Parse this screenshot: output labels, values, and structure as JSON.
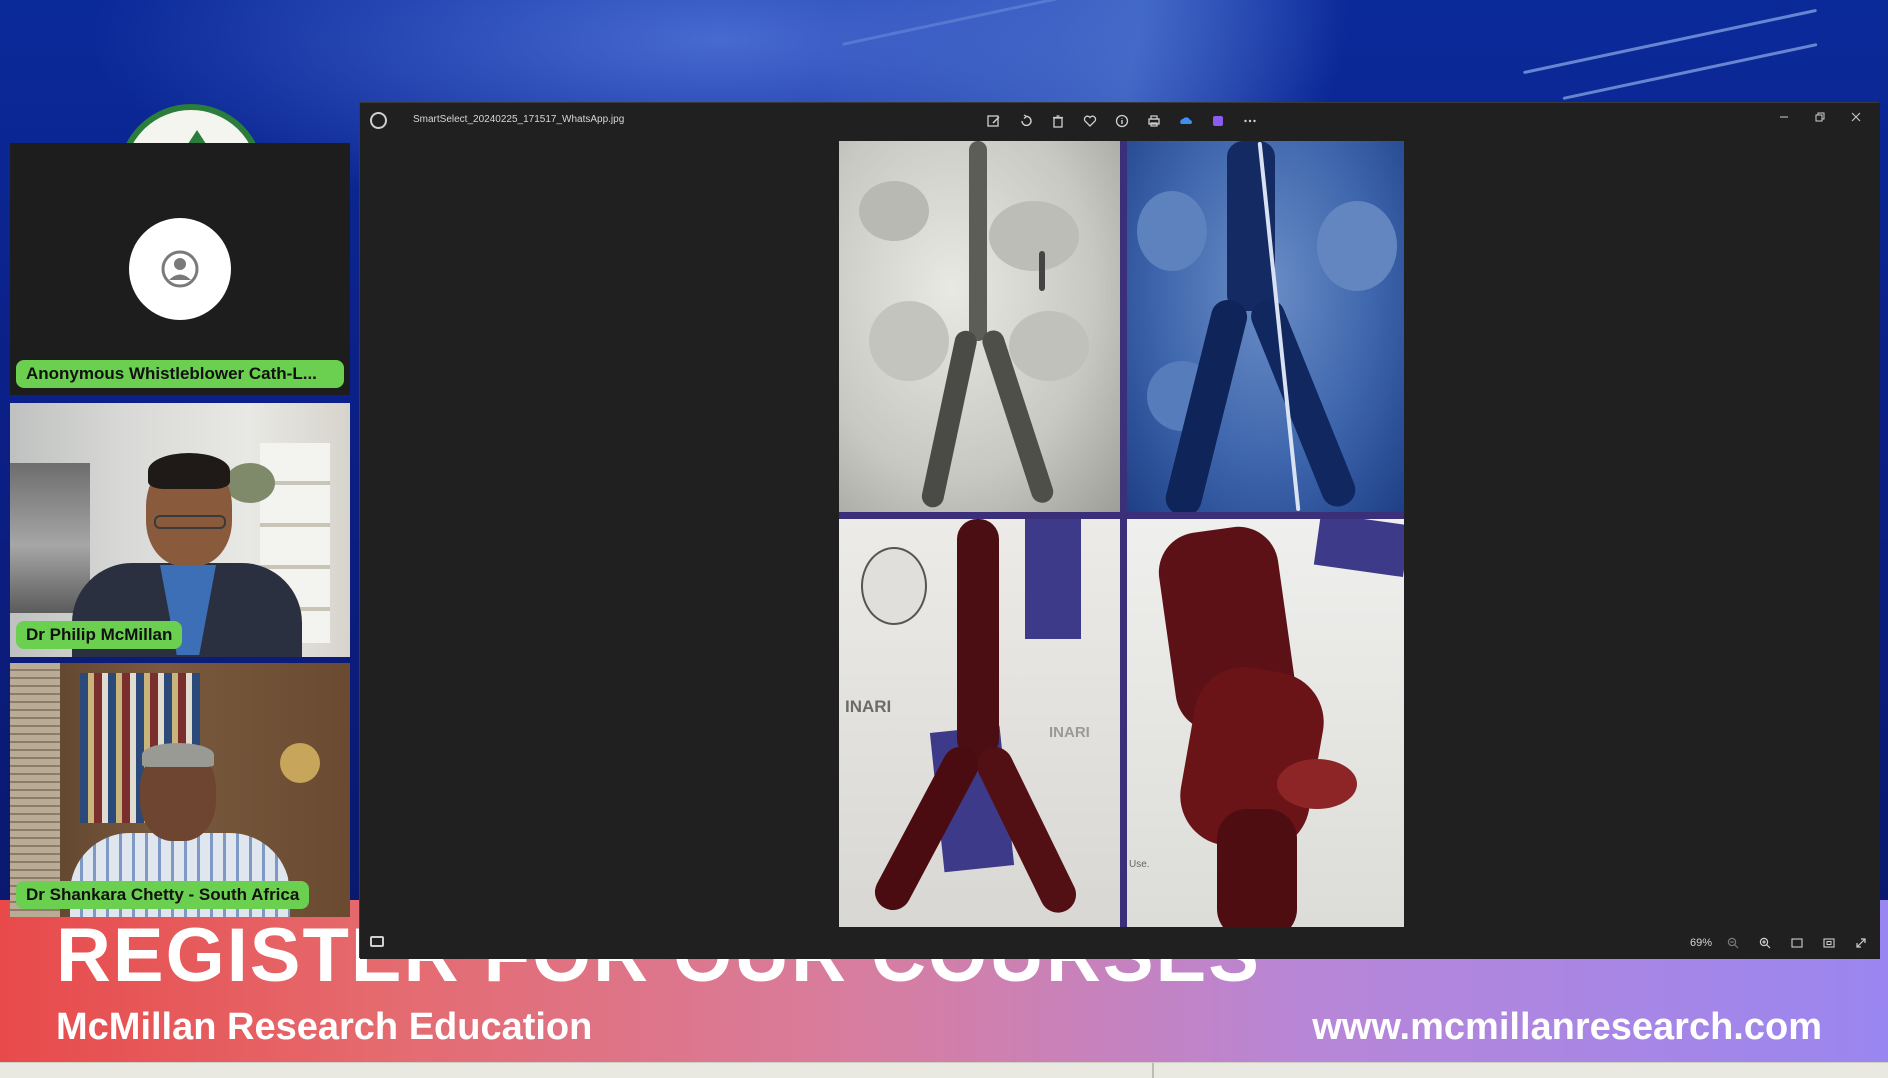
{
  "banner": {
    "title": "REGISTER FOR OUR COURSES",
    "org": "McMillan Research Education",
    "url": "www.mcmillanresearch.com"
  },
  "participants": [
    {
      "name": "Anonymous Whistleblower Cath-L...",
      "video": false
    },
    {
      "name": "Dr Philip McMillan",
      "video": true
    },
    {
      "name": "Dr Shankara Chetty - South Africa",
      "video": true
    }
  ],
  "viewer": {
    "filename": "SmartSelect_20240225_171517_WhatsApp.jpg",
    "toolbar": [
      "edit-icon",
      "rotate-icon",
      "delete-icon",
      "favorite-icon",
      "info-icon",
      "print-icon",
      "onedrive-icon",
      "clipchamp-icon",
      "more-icon"
    ],
    "window_controls": [
      "minimize",
      "restore",
      "close"
    ],
    "zoom": "69%",
    "image_labels": {
      "brand": "INARI",
      "note_fragment": "Use."
    }
  },
  "colors": {
    "name_pill": "#6bd04f",
    "viewer_bg": "#202020",
    "collage_border": "#3b2f7a"
  }
}
